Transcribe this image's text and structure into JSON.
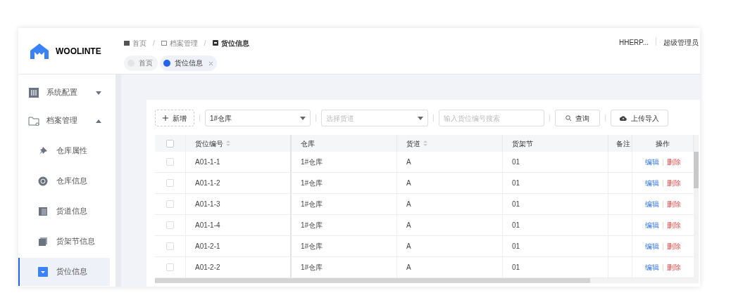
{
  "logo": {
    "text": "WOOLINTE"
  },
  "breadcrumb": [
    {
      "kind": "item",
      "text": "首页"
    },
    {
      "kind": "separator",
      "text": "/"
    },
    {
      "kind": "item",
      "text": "档案管理"
    },
    {
      "kind": "separator",
      "text": "/"
    },
    {
      "kind": "item",
      "text": "货位信息"
    }
  ],
  "tabs": [
    {
      "label": "首页",
      "selected": false,
      "closable": false
    },
    {
      "label": "货位信息",
      "selected": true,
      "closable": true
    }
  ],
  "header_right": {
    "system": "HHERP...",
    "user": "超级管理员"
  },
  "sidebar": {
    "items": [
      {
        "label": "系统配置",
        "expanded": false,
        "selected": false
      },
      {
        "label": "档案管理",
        "expanded": true,
        "selected": false,
        "children": [
          {
            "label": "仓库属性",
            "selected": false
          },
          {
            "label": "仓库信息",
            "selected": false
          },
          {
            "label": "货道信息",
            "selected": false
          },
          {
            "label": "货架节信息",
            "selected": false
          },
          {
            "label": "货位信息",
            "selected": true
          }
        ]
      }
    ]
  },
  "toolbar": {
    "add_button": "新增",
    "warehouse_select": {
      "value": "1#仓库"
    },
    "lane_select": {
      "placeholder": "选择货道"
    },
    "search_field": {
      "placeholder": "输入货位编号搜索"
    },
    "query_button": "查询",
    "import_button": "上传导入"
  },
  "table": {
    "select_all_checked": false,
    "columns": [
      {
        "label": "货位编号",
        "sortable": true
      },
      {
        "label": "仓库",
        "sortable": false
      },
      {
        "label": "货道",
        "sortable": true
      },
      {
        "label": "货架节",
        "sortable": false
      },
      {
        "label": "备注",
        "sortable": false
      },
      {
        "label": "操作",
        "sortable": false
      }
    ],
    "rows": [
      {
        "checked": false,
        "cells": [
          "A01-1-1",
          "1#仓库",
          "A",
          "01",
          ""
        ],
        "actions": [
          "编辑",
          "删除"
        ]
      },
      {
        "checked": false,
        "cells": [
          "A01-1-2",
          "1#仓库",
          "A",
          "01",
          ""
        ],
        "actions": [
          "编辑",
          "删除"
        ]
      },
      {
        "checked": false,
        "cells": [
          "A01-1-3",
          "1#仓库",
          "A",
          "01",
          ""
        ],
        "actions": [
          "编辑",
          "删除"
        ]
      },
      {
        "checked": false,
        "cells": [
          "A01-1-4",
          "1#仓库",
          "A",
          "01",
          ""
        ],
        "actions": [
          "编辑",
          "删除"
        ]
      },
      {
        "checked": false,
        "cells": [
          "A01-2-1",
          "1#仓库",
          "A",
          "01",
          ""
        ],
        "actions": [
          "编辑",
          "删除"
        ]
      },
      {
        "checked": false,
        "cells": [
          "A01-2-2",
          "1#仓库",
          "A",
          "01",
          ""
        ],
        "actions": [
          "编辑",
          "删除"
        ]
      }
    ]
  }
}
